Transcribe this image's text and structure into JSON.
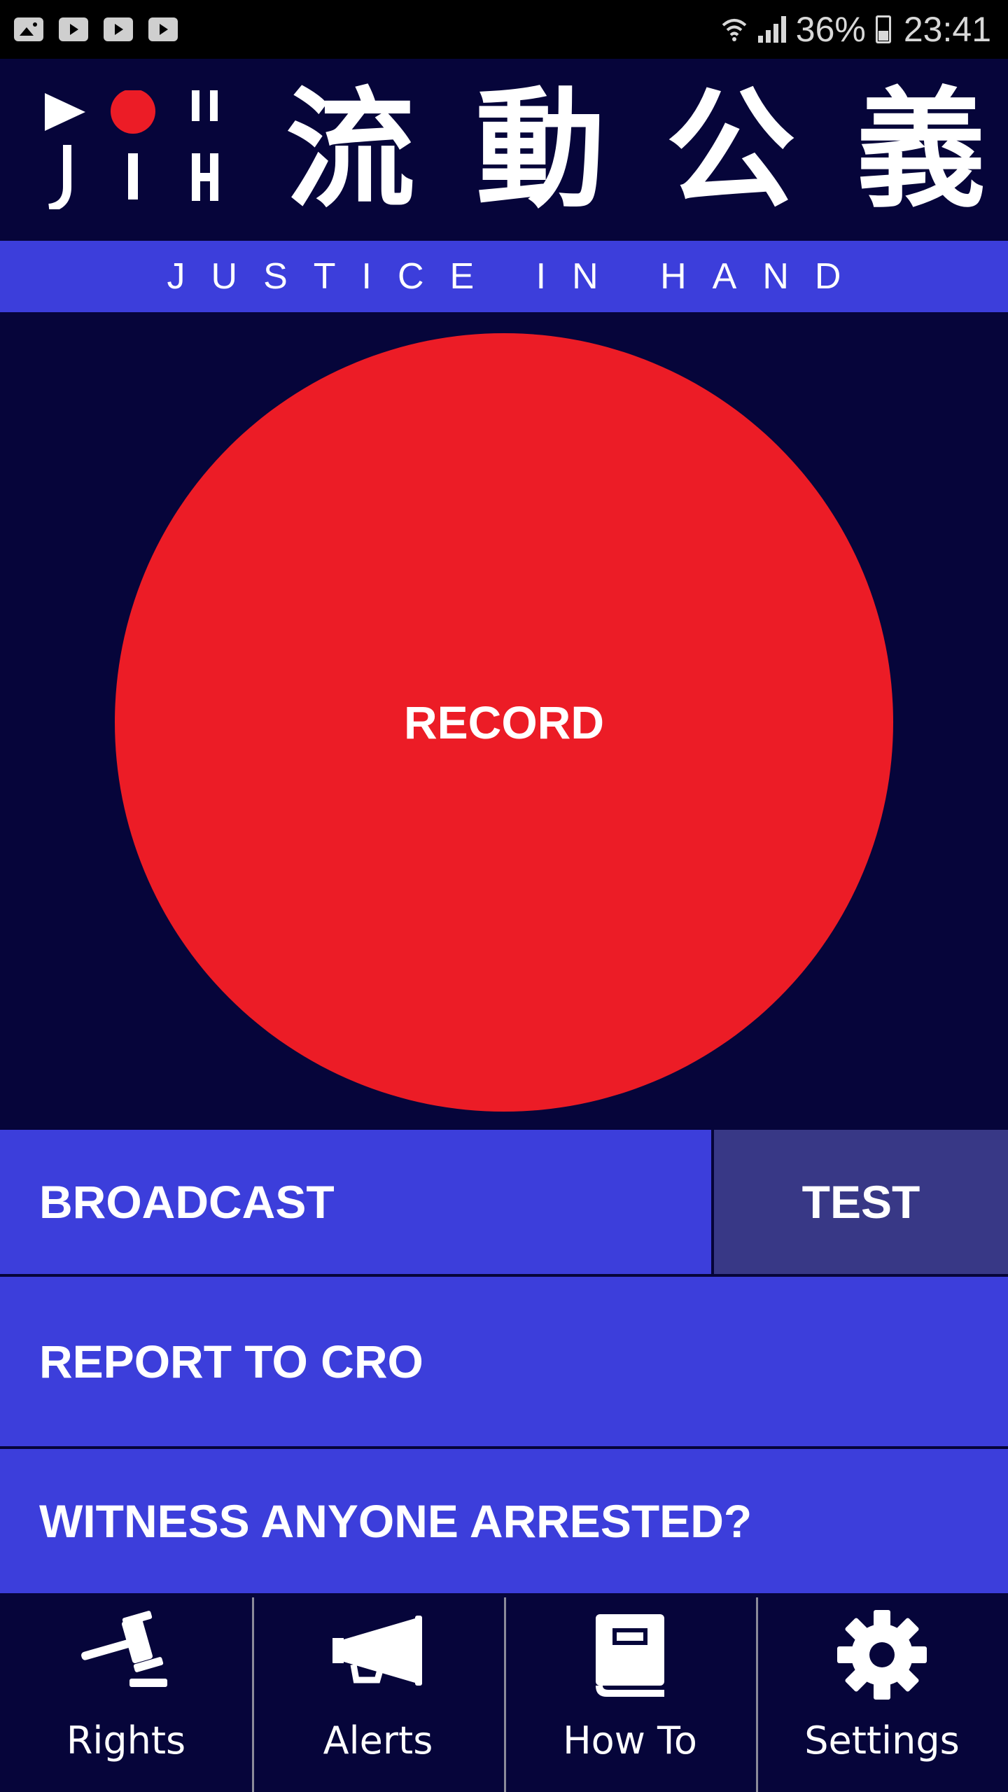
{
  "status_bar": {
    "left_icons": [
      "gallery-icon",
      "youtube-icon",
      "youtube-icon",
      "youtube-icon"
    ],
    "battery_percent": "36%",
    "time": "23:41"
  },
  "header": {
    "logo_letters": [
      "J",
      "I",
      "H"
    ],
    "title_chars": [
      "流",
      "動",
      "公",
      "義"
    ]
  },
  "tagline": "JUSTICE IN HAND",
  "record_button": "RECORD",
  "actions": {
    "broadcast": "BROADCAST",
    "test": "TEST",
    "report": "REPORT TO CRO",
    "witness": "WITNESS ANYONE ARRESTED?"
  },
  "bottom_nav": [
    {
      "label": "Rights",
      "icon": "gavel-icon"
    },
    {
      "label": "Alerts",
      "icon": "megaphone-icon"
    },
    {
      "label": "How To",
      "icon": "book-icon"
    },
    {
      "label": "Settings",
      "icon": "gear-icon"
    }
  ],
  "colors": {
    "background": "#06053a",
    "accent_blue": "#3c3edb",
    "test_button": "#383886",
    "record_red": "#ec1c26"
  }
}
